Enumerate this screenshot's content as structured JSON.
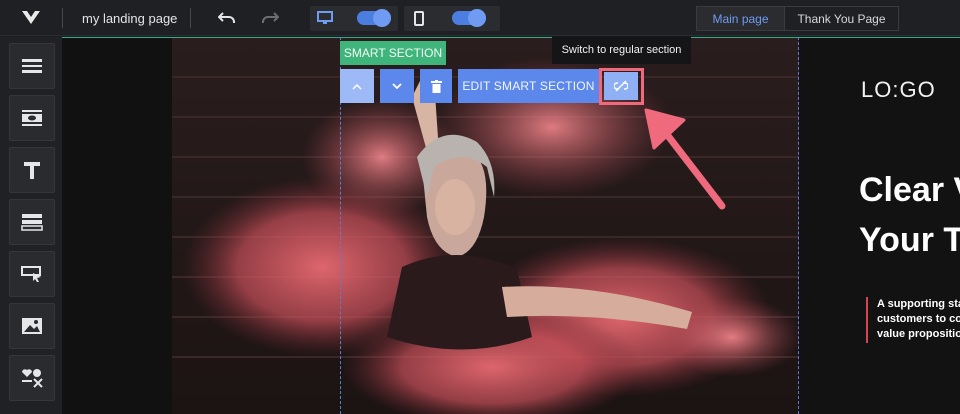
{
  "topbar": {
    "project_name": "my landing page",
    "tabs": [
      {
        "label": "Main page",
        "active": true
      },
      {
        "label": "Thank You Page",
        "active": false
      }
    ]
  },
  "sidebar": {
    "tools": [
      "section-icon",
      "smart-section-icon",
      "text-icon",
      "layout-icon",
      "button-icon",
      "image-icon",
      "widgets-icon"
    ]
  },
  "canvas": {
    "logo_text": "LO:GO",
    "headline_line1": "Clear V",
    "headline_line2": "Your T",
    "support_line1": "A supporting sta",
    "support_line2": "customers to co",
    "support_line3": "value propositio"
  },
  "smart_section": {
    "badge": "SMART SECTION",
    "edit_label": "EDIT SMART SECTION",
    "tooltip": "Switch to regular section"
  },
  "colors": {
    "accent_blue": "#5c88ec",
    "smart_green": "#3fb57c",
    "highlight_pink": "#f06a7e"
  }
}
